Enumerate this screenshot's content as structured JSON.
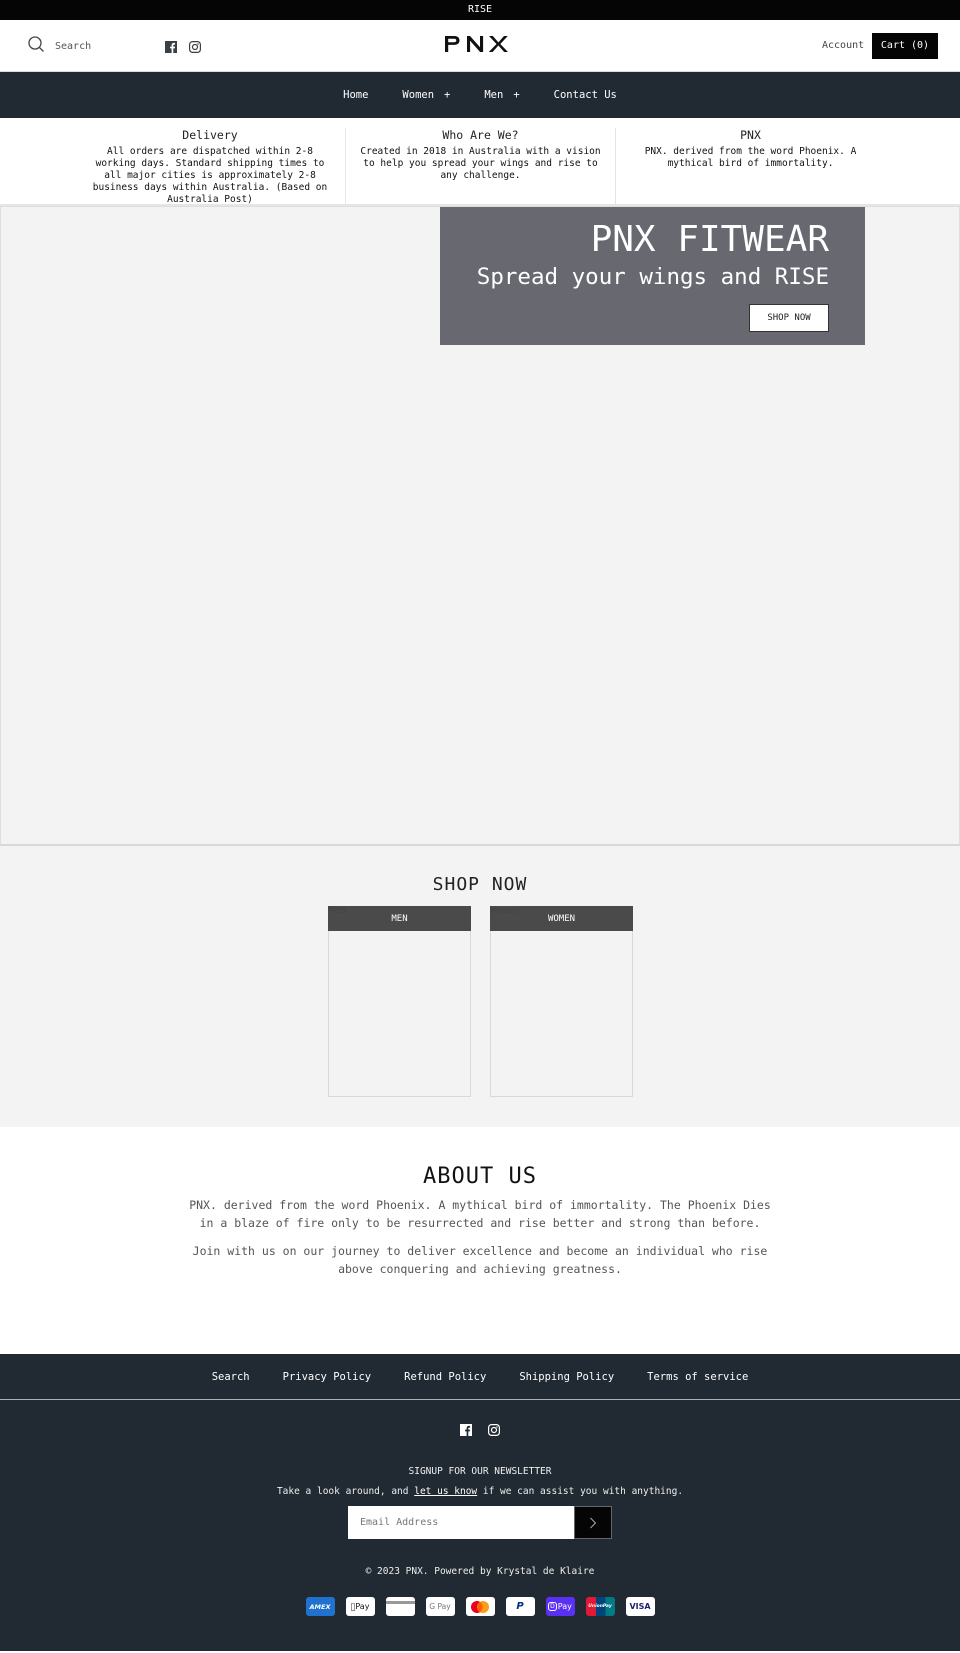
{
  "announcement": "RISE",
  "header": {
    "search_label": "Search",
    "logo": "PNX",
    "account_label": "Account",
    "cart_label": "Cart (0)",
    "socials": [
      "facebook-icon",
      "instagram-icon"
    ]
  },
  "nav": {
    "items": [
      {
        "label": "Home",
        "has_submenu": false
      },
      {
        "label": "Women",
        "has_submenu": true,
        "expander": "+"
      },
      {
        "label": "Men",
        "has_submenu": true,
        "expander": "+"
      },
      {
        "label": "Contact Us",
        "has_submenu": false
      }
    ]
  },
  "info": [
    {
      "title": "Delivery",
      "text": "All orders are dispatched within 2-8 working days. Standard shipping times to all major cities is approximately 2-8 business days within Australia. (Based on Australia Post)"
    },
    {
      "title": "Who Are We?",
      "text": "Created in 2018 in Australia with a vision to help you spread your wings and rise to any challenge."
    },
    {
      "title": "PNX",
      "text": "PNX. derived from the word Phoenix. A mythical bird of immortality."
    }
  ],
  "hero": {
    "title": "PNX FITWEAR",
    "subtitle": "Spread your wings and RISE",
    "button_label": "SHOP NOW",
    "box_color": "#676870"
  },
  "shop": {
    "title": "SHOP NOW",
    "cards": [
      {
        "label": "MEN",
        "alt": "Men"
      },
      {
        "label": "WOMEN",
        "alt": "Women"
      }
    ]
  },
  "about": {
    "title": "ABOUT US",
    "paragraphs": [
      "PNX. derived from the word Phoenix. A mythical bird of immortality. The Phoenix Dies in a blaze of fire only to be resurrected and rise better and strong than before.",
      "Join with us on our journey to deliver excellence and become an individual who rise above conquering and achieving greatness."
    ]
  },
  "footer": {
    "links": [
      "Search",
      "Privacy Policy",
      "Refund Policy",
      "Shipping Policy",
      "Terms of service"
    ],
    "newsletter_title": "SIGNUP FOR OUR NEWSLETTER",
    "newsletter_text_before": "Take a look around, and ",
    "newsletter_link": "let us know",
    "newsletter_text_after": " if we can assist you with anything.",
    "email_placeholder": "Email Address",
    "copyright": "© 2023 PNX. Powered by Krystal de Klaire",
    "payments": [
      {
        "name": "American Express",
        "label": "AMEX",
        "color": "#1f72cd"
      },
      {
        "name": "Apple Pay",
        "label": "Pay"
      },
      {
        "name": "Diners Club",
        "label": ""
      },
      {
        "name": "Google Pay",
        "label": "G Pay"
      },
      {
        "name": "Mastercard",
        "label": ""
      },
      {
        "name": "PayPal",
        "label": "P"
      },
      {
        "name": "Shop Pay",
        "label": "Pay",
        "color": "#5a31f4"
      },
      {
        "name": "Union Pay",
        "label": "UnionPay"
      },
      {
        "name": "Visa",
        "label": "VISA"
      }
    ]
  },
  "colors": {
    "announcement_bg": "#050505",
    "nav_bg": "#212a33",
    "footer_bg": "#212a33",
    "section_bg": "#f3f3f3",
    "card_bar": "#4a4a4a"
  }
}
